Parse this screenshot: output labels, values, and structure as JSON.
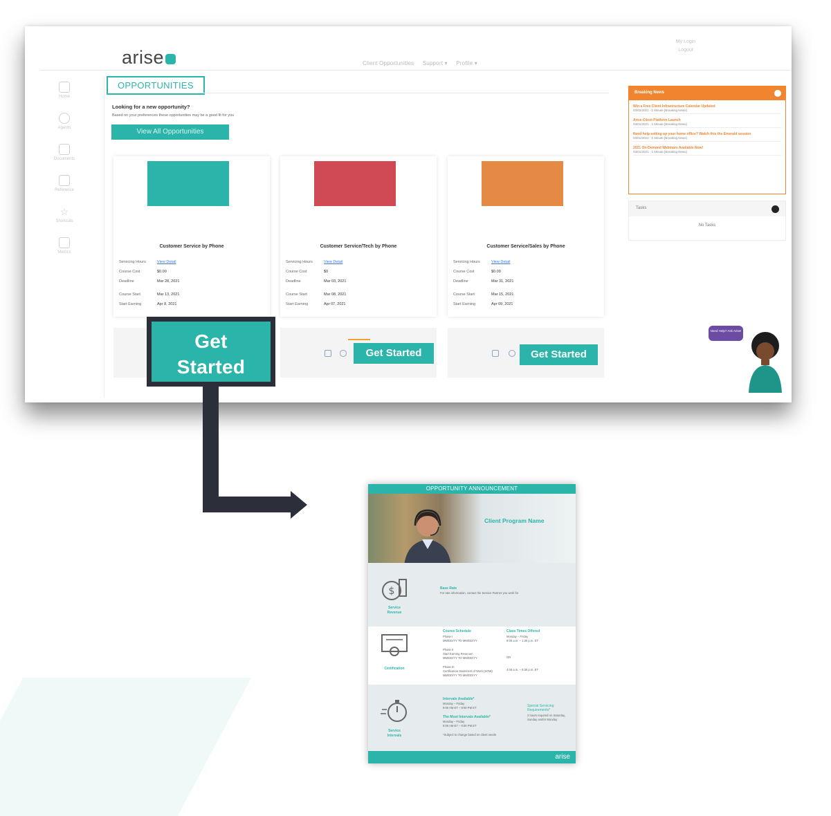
{
  "portal": {
    "logo_text": "arise",
    "nav": [
      "Client Opportunities",
      "Support ▾",
      "Profile ▾"
    ],
    "user_name": "My Login",
    "logout_label": "Logout",
    "sidebar": [
      {
        "label": "Home"
      },
      {
        "label": "Agents"
      },
      {
        "label": "Documents"
      },
      {
        "label": "Reference"
      },
      {
        "label": "Shortcuts"
      },
      {
        "label": "Metrics"
      }
    ],
    "section_title": "OPPORTUNITIES",
    "looking_text": "Looking for a new opportunity?",
    "based_text": "Based on your preferences these opportunities may be a good fit for you",
    "view_all_label": "View All Opportunities",
    "cards": [
      {
        "color": "#2bb5aa",
        "title": "Customer Service by Phone",
        "rows": [
          {
            "k": "Servicing Hours",
            "v": "View Detail"
          },
          {
            "k": "Course Cost",
            "v": "$0.00"
          },
          {
            "k": "Deadline",
            "v": "Mar 28, 2021"
          },
          {
            "k": "Course Start",
            "v": "Mar 13, 2021"
          },
          {
            "k": "Start Earning",
            "v": "Apr 8, 2021"
          }
        ],
        "button": "Get Started"
      },
      {
        "color": "#d04a55",
        "title": "Customer Service/Tech by Phone",
        "rows": [
          {
            "k": "Servicing Hours",
            "v": "View Detail"
          },
          {
            "k": "Course Cost",
            "v": "$0"
          },
          {
            "k": "Deadline",
            "v": "Mar 03, 2021"
          },
          {
            "k": "Course Start",
            "v": "Mar 08, 2021"
          },
          {
            "k": "Start Earning",
            "v": "Apr 07, 2021"
          }
        ],
        "button": "Get Started"
      },
      {
        "color": "#e48a45",
        "title": "Customer Service/Sales by Phone",
        "rows": [
          {
            "k": "Servicing Hours",
            "v": "View Detail"
          },
          {
            "k": "Course Cost",
            "v": "$0.00"
          },
          {
            "k": "Deadline",
            "v": "Mar 31, 2021"
          },
          {
            "k": "Course Start",
            "v": "Mar 15, 2021"
          },
          {
            "k": "Start Earning",
            "v": "Apr 09, 2021"
          }
        ],
        "button": "Get Started"
      }
    ],
    "news_panel": {
      "title": "Breaking News",
      "items": [
        {
          "title": "Win a Free Client Infrastructure Calendar Updated",
          "meta": "03/02/2021 · 1 Minute [Breaking News]"
        },
        {
          "title": "Arise Client Platform Launch",
          "meta": "03/01/2021 · 1 Minute [Breaking News]"
        },
        {
          "title": "Need help setting up your home office? Watch this the Emerald session",
          "meta": "03/01/2021 · 1 Minute [Breaking News]"
        },
        {
          "title": "2021 On-Demand Webinars Available Now!",
          "meta": "03/01/2021 · 1 Minute [Breaking News]"
        }
      ]
    },
    "tasks_panel": {
      "title": "Tasks",
      "empty_text": "No Tasks"
    },
    "assistant_bubble": "Need Help? Ask Arise!"
  },
  "callout": {
    "label_line1": "Get",
    "label_line2": "Started"
  },
  "flyer": {
    "banner": "OPPORTUNITY ANNOUNCEMENT",
    "client_name": "Client Program Name",
    "revenue": {
      "icon_label_1": "Service",
      "icon_label_2": "Revenue",
      "title": "Base Rate",
      "text": "For rate information, contact the Service Partner you work for"
    },
    "certification": {
      "icon_label": "Certification",
      "schedule_title": "Course Schedule",
      "phase1": "Phase I",
      "phase1_dates": "MM/DD/YY TO MM/DD/YY",
      "phase2": "Phase II",
      "phase2_sub": "Start Earning Revenue!",
      "phase2_dates": "MM/DD/YY TO MM/DD/YY",
      "phase3": "Phase III",
      "phase3_sub": "Certification Statement of Work (SOW)",
      "phase3_dates": "MM/DD/YY TO MM/DD/YY",
      "times_title": "Class Times Offered",
      "times_days": "Monday – Friday",
      "times_1": "9:00 a.m. – 1:30 p.m. ET",
      "times_or": "OR",
      "times_2": "4:00 a.m. – 8:30 p.m. ET"
    },
    "intervals": {
      "icon_label_1": "Service",
      "icon_label_2": "Intervals",
      "avail_title": "Intervals Available*",
      "avail_days": "Monday – Friday",
      "avail_hours": "9:00 AM ET – 9:00 PM ET",
      "most_title": "The Most Intervals Available*",
      "most_days": "Monday – Friday",
      "most_hours": "9:00 AM ET – 9:00 PM ET",
      "note": "*Subject to change based on client needs",
      "special_title": "Special Servicing Requirements*",
      "special_text": "2 hours required on Saturday, Sunday and/or Monday"
    },
    "footer_logo": "arise"
  }
}
